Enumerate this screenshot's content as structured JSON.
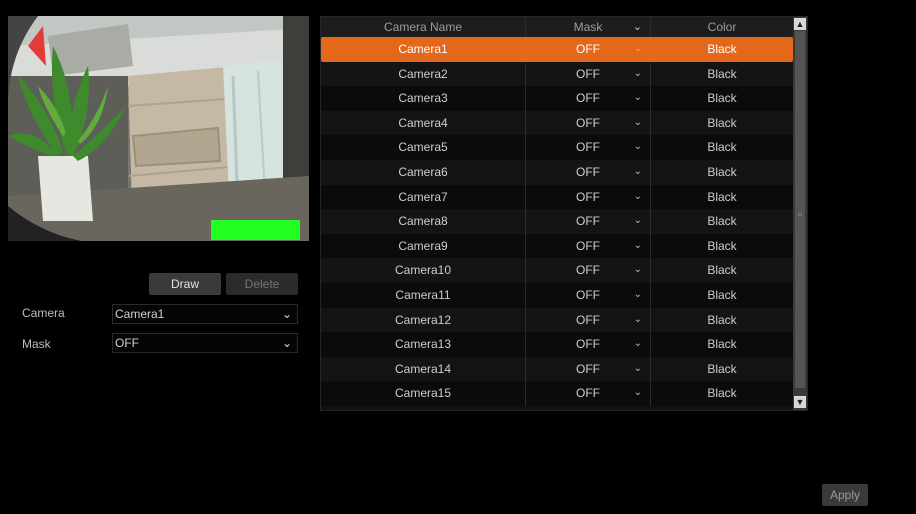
{
  "preview": {
    "mask_color": "#22ff22"
  },
  "actions": {
    "draw_label": "Draw",
    "delete_label": "Delete",
    "apply_label": "Apply"
  },
  "form": {
    "camera_label": "Camera",
    "camera_value": "Camera1",
    "mask_label": "Mask",
    "mask_value": "OFF"
  },
  "table": {
    "headers": {
      "name": "Camera Name",
      "mask": "Mask",
      "color": "Color"
    },
    "rows": [
      {
        "name": "Camera1",
        "mask": "OFF",
        "color": "Black"
      },
      {
        "name": "Camera2",
        "mask": "OFF",
        "color": "Black"
      },
      {
        "name": "Camera3",
        "mask": "OFF",
        "color": "Black"
      },
      {
        "name": "Camera4",
        "mask": "OFF",
        "color": "Black"
      },
      {
        "name": "Camera5",
        "mask": "OFF",
        "color": "Black"
      },
      {
        "name": "Camera6",
        "mask": "OFF",
        "color": "Black"
      },
      {
        "name": "Camera7",
        "mask": "OFF",
        "color": "Black"
      },
      {
        "name": "Camera8",
        "mask": "OFF",
        "color": "Black"
      },
      {
        "name": "Camera9",
        "mask": "OFF",
        "color": "Black"
      },
      {
        "name": "Camera10",
        "mask": "OFF",
        "color": "Black"
      },
      {
        "name": "Camera11",
        "mask": "OFF",
        "color": "Black"
      },
      {
        "name": "Camera12",
        "mask": "OFF",
        "color": "Black"
      },
      {
        "name": "Camera13",
        "mask": "OFF",
        "color": "Black"
      },
      {
        "name": "Camera14",
        "mask": "OFF",
        "color": "Black"
      },
      {
        "name": "Camera15",
        "mask": "OFF",
        "color": "Black"
      }
    ],
    "selected_index": 0,
    "selected_color": "#e3681c"
  },
  "icons": {
    "dropdown": "chevron-down-icon",
    "scroll_up": "scroll-up-icon",
    "scroll_down": "scroll-down-icon"
  }
}
